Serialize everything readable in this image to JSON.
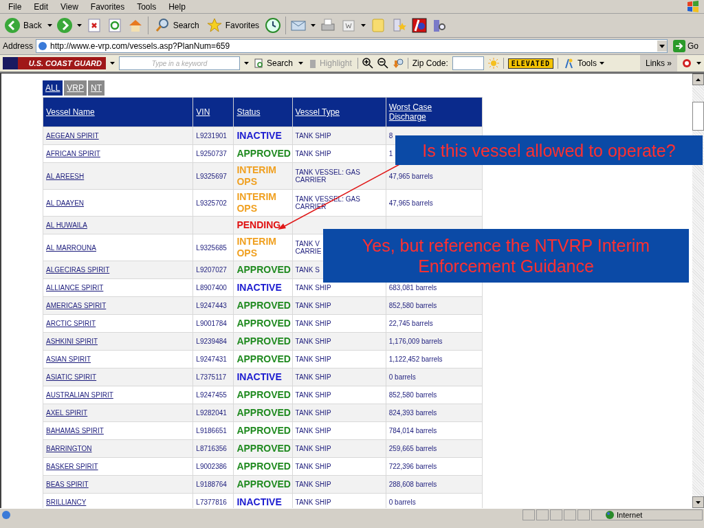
{
  "menu": [
    "File",
    "Edit",
    "View",
    "Favorites",
    "Tools",
    "Help"
  ],
  "toolbar": [
    {
      "kind": "back",
      "label": "Back",
      "dropdown": true
    },
    {
      "kind": "forward",
      "dropdown": true
    },
    {
      "kind": "stop"
    },
    {
      "kind": "refresh"
    },
    {
      "kind": "home"
    },
    {
      "kind": "search",
      "label": "Search"
    },
    {
      "kind": "favorites",
      "label": "Favorites"
    },
    {
      "kind": "history"
    },
    {
      "kind": "mail",
      "dropdown": true
    },
    {
      "kind": "print"
    },
    {
      "kind": "edit",
      "dropdown": true
    },
    {
      "kind": "notes"
    },
    {
      "kind": "messenger"
    },
    {
      "kind": "badge"
    },
    {
      "kind": "research"
    }
  ],
  "address": {
    "label": "Address",
    "url": "http://www.e-vrp.com/vessels.asp?PlanNum=659",
    "go": "Go"
  },
  "links_chevron": "»",
  "links_bar": {
    "brand": "U.S. COAST GUARD",
    "keyword_placeholder": "Type in a keyword",
    "search": "Search",
    "highlight": "Highlight",
    "zip_label": "Zip Code:",
    "alert": "ELEVATED",
    "tools": "Tools",
    "links": "Links"
  },
  "filter_tabs": [
    {
      "label": "ALL",
      "selected": true
    },
    {
      "label": "VRP",
      "selected": false
    },
    {
      "label": "NT",
      "selected": false
    }
  ],
  "table": {
    "columns": [
      "Vessel Name",
      "VIN",
      "Status",
      "Vessel Type",
      "Worst Case Discharge"
    ],
    "rows": [
      {
        "name": "AEGEAN SPIRIT",
        "vin": "L9231901",
        "status": "INACTIVE",
        "color": "#1a1ad0",
        "type": "TANK SHIP",
        "discharge": "8"
      },
      {
        "name": "AFRICAN SPIRIT",
        "vin": "L9250737",
        "status": "APPROVED",
        "color": "#1f8a1f",
        "type": "TANK SHIP",
        "discharge": "1"
      },
      {
        "name": "AL AREESH",
        "vin": "L9325697",
        "status": "INTERIM OPS",
        "color": "#f0a020",
        "type": "TANK VESSEL: GAS CARRIER",
        "discharge": "47,965 barrels"
      },
      {
        "name": "AL DAAYEN",
        "vin": "L9325702",
        "status": "INTERIM OPS",
        "color": "#f0a020",
        "type": "TANK VESSEL: GAS CARRIER",
        "discharge": "47,965 barrels"
      },
      {
        "name": "AL HUWAILA",
        "vin": "",
        "status": "PENDING",
        "color": "#e01010",
        "type": "",
        "discharge": ""
      },
      {
        "name": "AL MARROUNA",
        "vin": "L9325685",
        "status": "INTERIM OPS",
        "color": "#f0a020",
        "type": "TANK V\nCARRIE",
        "discharge": ""
      },
      {
        "name": "ALGECIRAS SPIRIT",
        "vin": "L9207027",
        "status": "APPROVED",
        "color": "#1f8a1f",
        "type": "TANK S",
        "discharge": ""
      },
      {
        "name": "ALLIANCE SPIRIT",
        "vin": "L8907400",
        "status": "INACTIVE",
        "color": "#1a1ad0",
        "type": "TANK SHIP",
        "discharge": "683,081 barrels"
      },
      {
        "name": "AMERICAS SPIRIT",
        "vin": "L9247443",
        "status": "APPROVED",
        "color": "#1f8a1f",
        "type": "TANK SHIP",
        "discharge": "852,580 barrels"
      },
      {
        "name": "ARCTIC SPIRIT",
        "vin": "L9001784",
        "status": "APPROVED",
        "color": "#1f8a1f",
        "type": "TANK SHIP",
        "discharge": "22,745 barrels"
      },
      {
        "name": "ASHKINI SPIRIT",
        "vin": "L9239484",
        "status": "APPROVED",
        "color": "#1f8a1f",
        "type": "TANK SHIP",
        "discharge": "1,176,009 barrels"
      },
      {
        "name": "ASIAN SPIRIT",
        "vin": "L9247431",
        "status": "APPROVED",
        "color": "#1f8a1f",
        "type": "TANK SHIP",
        "discharge": "1,122,452 barrels"
      },
      {
        "name": "ASIATIC SPIRIT",
        "vin": "L7375117",
        "status": "INACTIVE",
        "color": "#1a1ad0",
        "type": "TANK SHIP",
        "discharge": "0 barrels"
      },
      {
        "name": "AUSTRALIAN SPIRIT",
        "vin": "L9247455",
        "status": "APPROVED",
        "color": "#1f8a1f",
        "type": "TANK SHIP",
        "discharge": "852,580 barrels"
      },
      {
        "name": "AXEL SPIRIT",
        "vin": "L9282041",
        "status": "APPROVED",
        "color": "#1f8a1f",
        "type": "TANK SHIP",
        "discharge": "824,393 barrels"
      },
      {
        "name": "BAHAMAS SPIRIT",
        "vin": "L9186651",
        "status": "APPROVED",
        "color": "#1f8a1f",
        "type": "TANK SHIP",
        "discharge": "784,014 barrels"
      },
      {
        "name": "BARRINGTON",
        "vin": "L8716356",
        "status": "APPROVED",
        "color": "#1f8a1f",
        "type": "TANK SHIP",
        "discharge": "259,665 barrels"
      },
      {
        "name": "BASKER SPIRIT",
        "vin": "L9002386",
        "status": "APPROVED",
        "color": "#1f8a1f",
        "type": "TANK SHIP",
        "discharge": "722,396 barrels"
      },
      {
        "name": "BEAS SPIRIT",
        "vin": "L9188764",
        "status": "APPROVED",
        "color": "#1f8a1f",
        "type": "TANK SHIP",
        "discharge": "288,608 barrels"
      },
      {
        "name": "BRILLIANCY",
        "vin": "L7377816",
        "status": "INACTIVE",
        "color": "#1a1ad0",
        "type": "TANK SHIP",
        "discharge": "0 barrels"
      }
    ]
  },
  "callouts": [
    {
      "text": "Is this vessel allowed to operate?"
    },
    {
      "text": "Yes, but reference the NTVRP Interim Enforcement Guidance"
    }
  ],
  "status_bar": {
    "zone": "Internet"
  }
}
